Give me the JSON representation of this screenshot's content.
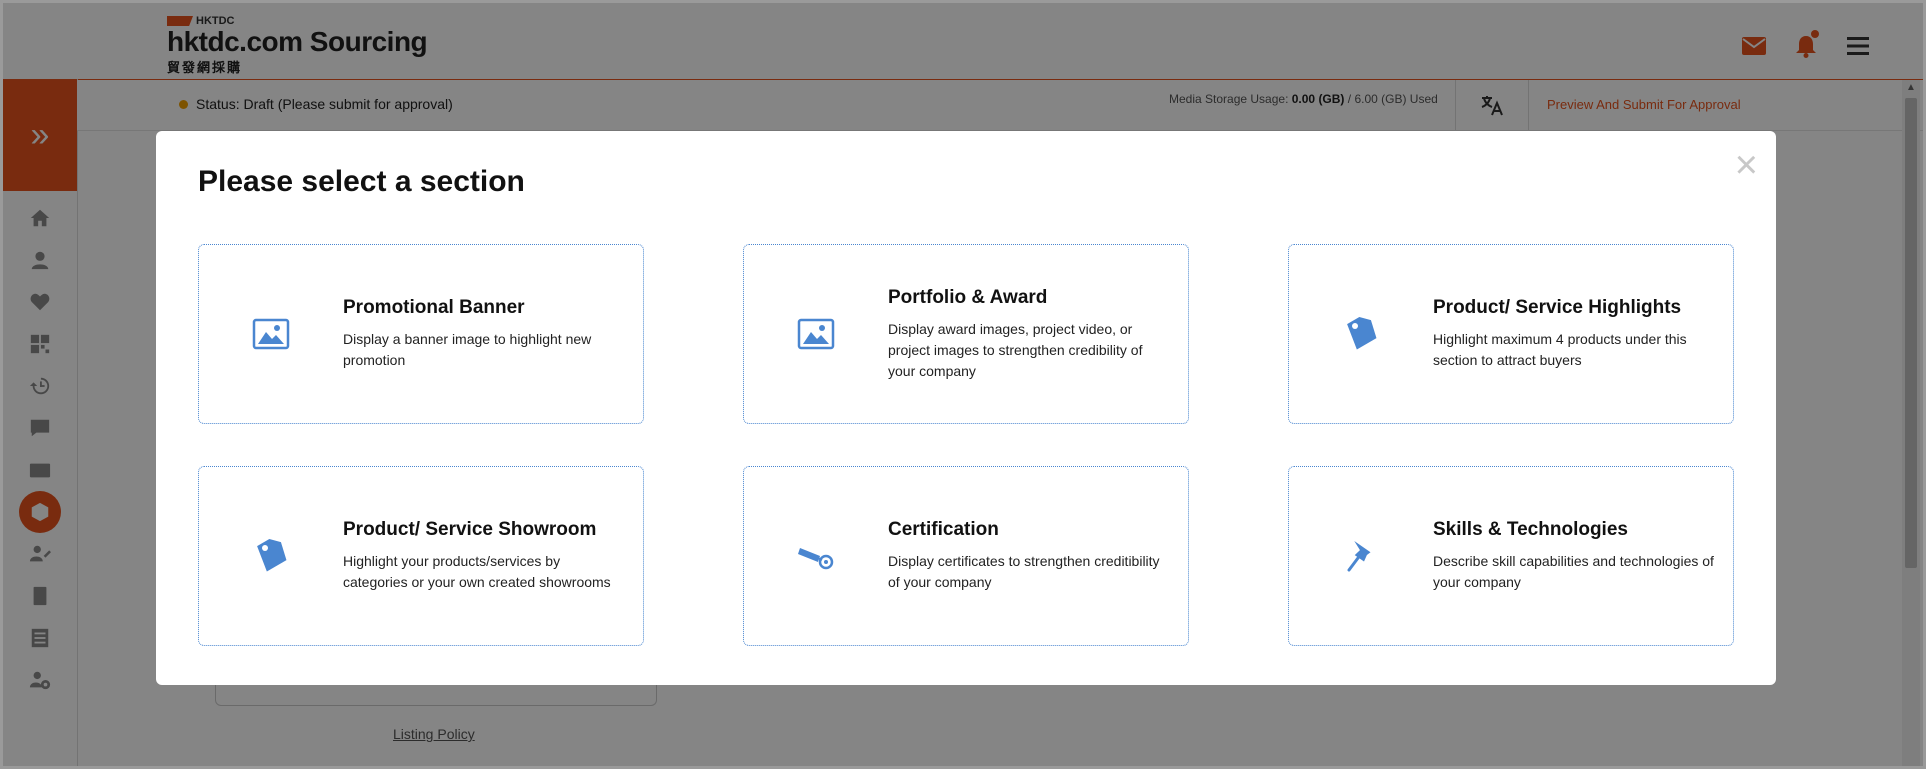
{
  "header": {
    "logo_small": "HKTDC",
    "logo_main": "hktdc.com Sourcing",
    "logo_sub": "貿發網採購"
  },
  "sidebar": {
    "toggle_icon": "double-chevron-right-icon",
    "items": [
      {
        "icon": "home-icon"
      },
      {
        "icon": "user-icon"
      },
      {
        "icon": "heart-icon"
      },
      {
        "icon": "dashboard-icon"
      },
      {
        "icon": "history-icon"
      },
      {
        "icon": "chat-icon"
      },
      {
        "icon": "card-icon"
      },
      {
        "icon": "box-icon",
        "active": true
      },
      {
        "icon": "user-edit-icon"
      },
      {
        "icon": "document-icon"
      },
      {
        "icon": "list-icon"
      },
      {
        "icon": "user-settings-icon"
      }
    ]
  },
  "statusbar": {
    "status_text": "Status: Draft (Please submit for approval)",
    "storage_label": "Media Storage Usage:",
    "storage_used": "0.00 (GB)",
    "storage_total": "/ 6.00 (GB) Used",
    "preview_link": "Preview And Submit For Approval"
  },
  "page": {
    "listing_policy": "Listing Policy"
  },
  "modal": {
    "title": "Please select a section",
    "close_glyph": "×",
    "sections": [
      {
        "title": "Promotional Banner",
        "desc": "Display a banner image to highlight new promotion",
        "icon": "image-icon"
      },
      {
        "title": "Portfolio & Award",
        "desc": "Display award images, project video, or project images to strengthen credibility of your company",
        "icon": "image-icon"
      },
      {
        "title": "Product/ Service Highlights",
        "desc": "Highlight maximum 4 products under this section to attract buyers",
        "icon": "tag-icon"
      },
      {
        "title": "Product/ Service Showroom",
        "desc": "Highlight your products/services by categories or your own created showrooms",
        "icon": "tag-icon"
      },
      {
        "title": "Certification",
        "desc": "Display certificates to strengthen creditibility of your company",
        "icon": "certificate-icon"
      },
      {
        "title": "Skills & Technologies",
        "desc": "Describe skill capabilities and technologies of your company",
        "icon": "pin-icon"
      }
    ]
  },
  "colors": {
    "brand": "#e8541e",
    "card_border": "#4a86d0",
    "icon": "#4a86d0"
  }
}
